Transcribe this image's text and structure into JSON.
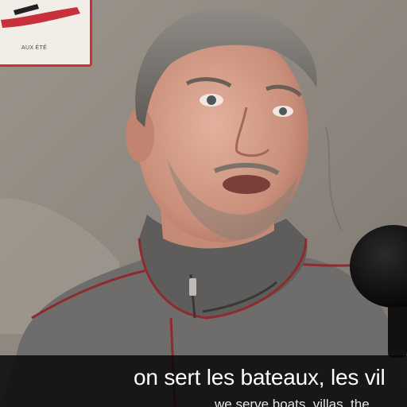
{
  "scene": {
    "description_icon": "interview-frame",
    "colors": {
      "wall": "#8e8880",
      "sweater": "#6f6d6b",
      "piping": "#8e2b2e",
      "sign_border": "#c8303a",
      "caption_bg": "#08080a"
    }
  },
  "sign": {
    "text": "AUX ÉTÉ"
  },
  "captions": {
    "french": "on sert les bateaux, les vil",
    "english": "we serve boats, villas, the"
  }
}
